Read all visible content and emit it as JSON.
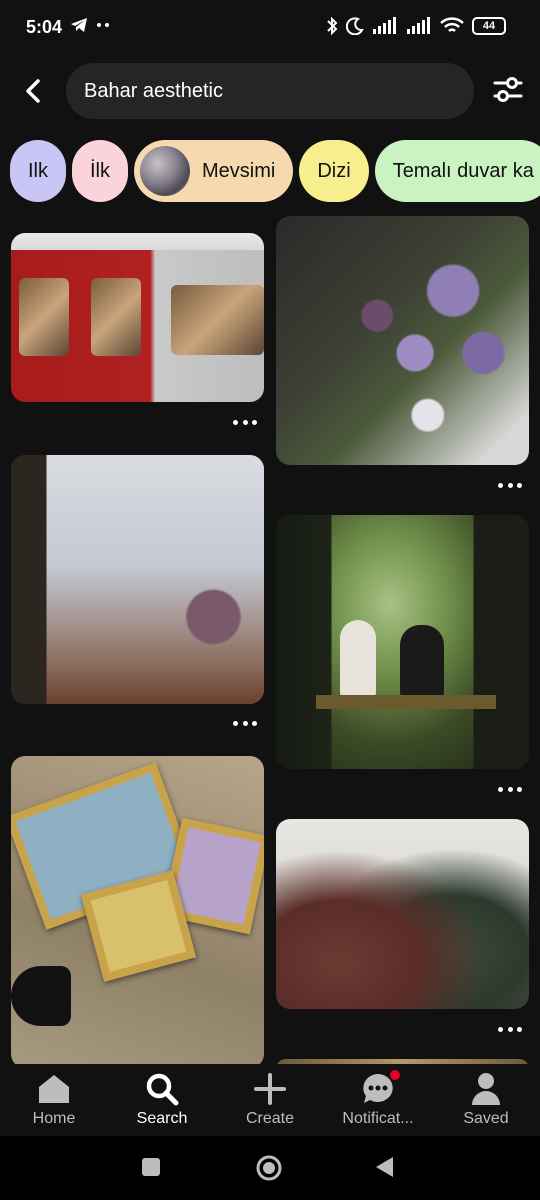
{
  "status_bar": {
    "time": "5:04",
    "battery": "44"
  },
  "search": {
    "query": "Bahar aesthetic"
  },
  "chips": [
    {
      "label": "Ilk",
      "color": "#c9c6f5"
    },
    {
      "label": "İlk",
      "color": "#fbd3da"
    },
    {
      "label": "Mevsimi",
      "color": "#f7d9b0"
    },
    {
      "label": "Dizi",
      "color": "#f7ef8e"
    },
    {
      "label": "Temalı duvar ka",
      "color": "#c9f3c0"
    }
  ],
  "bottom_nav": {
    "items": [
      {
        "label": "Home",
        "icon": "home-icon"
      },
      {
        "label": "Search",
        "icon": "search-icon",
        "active": true
      },
      {
        "label": "Create",
        "icon": "plus-icon"
      },
      {
        "label": "Notificat...",
        "icon": "chat-bubble-icon",
        "badge": true
      },
      {
        "label": "Saved",
        "icon": "person-icon"
      }
    ]
  },
  "colors": {
    "background": "#111111",
    "accent_red": "#e60023"
  }
}
